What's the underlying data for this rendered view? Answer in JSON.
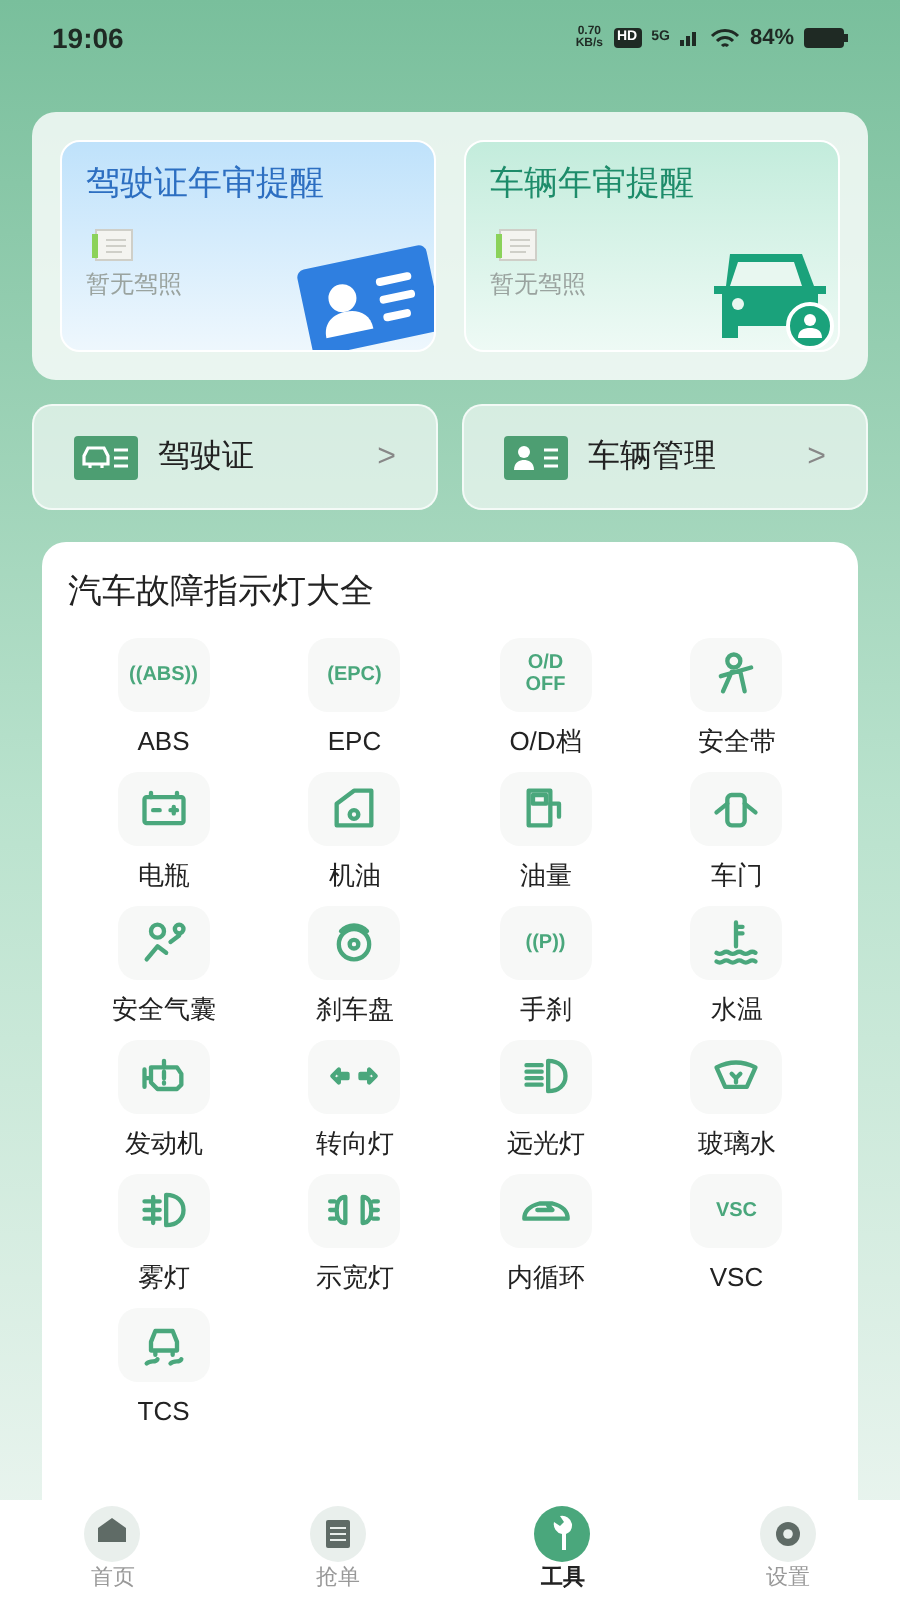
{
  "status_bar": {
    "time": "19:06",
    "speed": "0.70\nKB/s",
    "hd": "HD",
    "network": "5G",
    "battery": "84%"
  },
  "reminders": [
    {
      "kind": "license",
      "title": "驾驶证年审提醒",
      "empty": "暂无驾照"
    },
    {
      "kind": "vehicle",
      "title": "车辆年审提醒",
      "empty": "暂无驾照"
    }
  ],
  "shortcuts": [
    {
      "kind": "license",
      "label": "驾驶证",
      "arrow": ">"
    },
    {
      "kind": "vehicle",
      "label": "车辆管理",
      "arrow": ">"
    }
  ],
  "indicators": {
    "title": "汽车故障指示灯大全",
    "items": [
      {
        "kind": "text",
        "icon_text": "((ABS))",
        "label": "ABS"
      },
      {
        "kind": "text",
        "icon_text": "(EPC)",
        "label": "EPC"
      },
      {
        "kind": "text",
        "icon_text": "O/D\nOFF",
        "label": "O/D档"
      },
      {
        "kind": "seatbelt",
        "label": "安全带"
      },
      {
        "kind": "battery",
        "label": "电瓶"
      },
      {
        "kind": "oil",
        "label": "机油"
      },
      {
        "kind": "fuel",
        "label": "油量"
      },
      {
        "kind": "door",
        "label": "车门"
      },
      {
        "kind": "airbag",
        "label": "安全气囊"
      },
      {
        "kind": "disc",
        "label": "刹车盘"
      },
      {
        "kind": "text",
        "icon_text": "((P))",
        "label": "手刹"
      },
      {
        "kind": "temp",
        "label": "水温"
      },
      {
        "kind": "engine",
        "label": "发动机"
      },
      {
        "kind": "turn",
        "label": "转向灯"
      },
      {
        "kind": "beam",
        "label": "远光灯"
      },
      {
        "kind": "washer",
        "label": "玻璃水"
      },
      {
        "kind": "fog",
        "label": "雾灯"
      },
      {
        "kind": "width",
        "label": "示宽灯"
      },
      {
        "kind": "recirc",
        "label": "内循环"
      },
      {
        "kind": "text",
        "icon_text": "VSC",
        "label": "VSC"
      },
      {
        "kind": "tcs",
        "label": "TCS"
      }
    ]
  },
  "nav": [
    {
      "kind": "home",
      "label": "首页",
      "selected": false
    },
    {
      "kind": "orders",
      "label": "抢单",
      "selected": false
    },
    {
      "kind": "tools",
      "label": "工具",
      "selected": true
    },
    {
      "kind": "settings",
      "label": "设置",
      "selected": false
    }
  ]
}
